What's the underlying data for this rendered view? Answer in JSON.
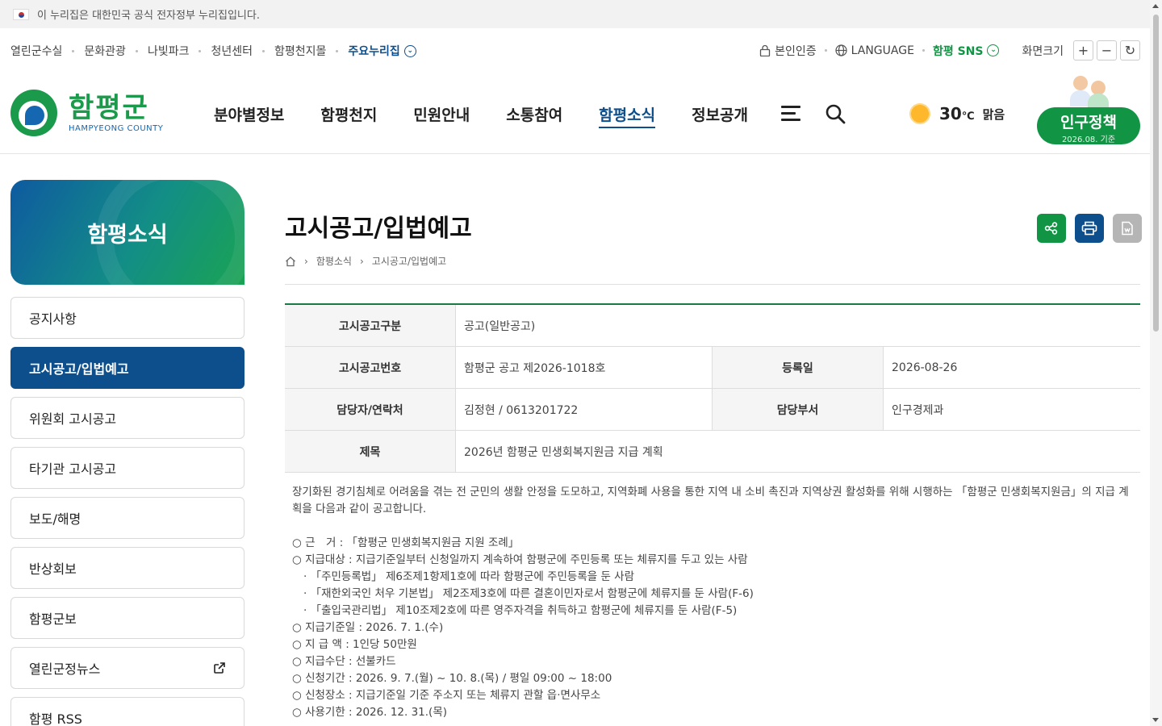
{
  "gov_banner": {
    "text": "이 누리집은 대한민국 공식 전자정부 누리집입니다."
  },
  "util_left": {
    "links": [
      "열린군수실",
      "문화관광",
      "나빛파크",
      "청년센터",
      "함평천지몰"
    ],
    "featured": "주요누리집"
  },
  "util_right": {
    "auth": "본인인증",
    "language": "LANGUAGE",
    "sns": "함평 SNS",
    "zoom_label": "화면크기",
    "zoom_in": "+",
    "zoom_out": "−",
    "reset": "↻"
  },
  "logo": {
    "ko": "함평군",
    "en": "HAMPYEONG COUNTY"
  },
  "gnb": [
    "분야별정보",
    "함평천지",
    "민원안내",
    "소통참여",
    "함평소식",
    "정보공개"
  ],
  "weather": {
    "temp": "30",
    "unit": "℃",
    "status": "맑음"
  },
  "population": {
    "title": "인구정책",
    "date": "2026.08. 기준"
  },
  "sidebar": {
    "title": "함평소식",
    "items": [
      "공지사항",
      "고시공고/입법예고",
      "위원회 고시공고",
      "타기관 고시공고",
      "보도/해명",
      "반상회보",
      "함평군보",
      "열린군정뉴스",
      "함평 RSS"
    ]
  },
  "page": {
    "title": "고시공고/입법예고",
    "breadcrumb": [
      "함평소식",
      "고시공고/입법예고"
    ]
  },
  "notice": {
    "type_label": "고시공고구분",
    "type": "공고(일반공고)",
    "no_label": "고시공고번호",
    "no": "함평군 공고 제2026-1018호",
    "date_label": "등록일",
    "date": "2026-08-26",
    "contact_label": "담당자/연락처",
    "contact": "김정현 / 0613201722",
    "dept_label": "담당부서",
    "dept": "인구경제과",
    "subject_label": "제목",
    "subject": "2026년 함평군 민생회복지원금 지급 계획"
  },
  "body": {
    "intro": "장기화된 경기침체로 어려움을 겪는 전 군민의 생활 안정을 도모하고, 지역화폐 사용을 통한 지역 내 소비 촉진과 지역상권 활성화를 위해 시행하는 「함평군 민생회복지원금」의 지급 계획을 다음과 같이 공고합니다.",
    "lines": [
      "○ 근　거 : 「함평군 민생회복지원금 지원 조례」",
      "○ 지급대상 : 지급기준일부터 신청일까지 계속하여 함평군에 주민등록 또는 체류지를 두고 있는 사람",
      "· 「주민등록법」 제6조제1항제1호에 따라 함평군에 주민등록을 둔 사람",
      "· 「재한외국인 처우 기본법」 제2조제3호에 따른 결혼이민자로서 함평군에 체류지를 둔 사람(F-6)",
      "· 「출입국관리법」 제10조제2호에 따른 영주자격을 취득하고 함평군에 체류지를 둔 사람(F-5)",
      "○ 지급기준일 : 2026. 7. 1.(수)",
      "○ 지 급 액 : 1인당 50만원",
      "○ 지급수단 : 선불카드",
      "○ 신청기간 : 2026. 9. 7.(월) ~ 10. 8.(목) / 평일 09:00 ~ 18:00",
      "○ 신청장소 : 지급기준일 기준 주소지 또는 체류지 관할 읍·면사무소",
      "○ 사용기한 : 2026. 12. 31.(목)"
    ]
  },
  "colors": {
    "green": "#119544",
    "navy": "#0d4f8c"
  }
}
